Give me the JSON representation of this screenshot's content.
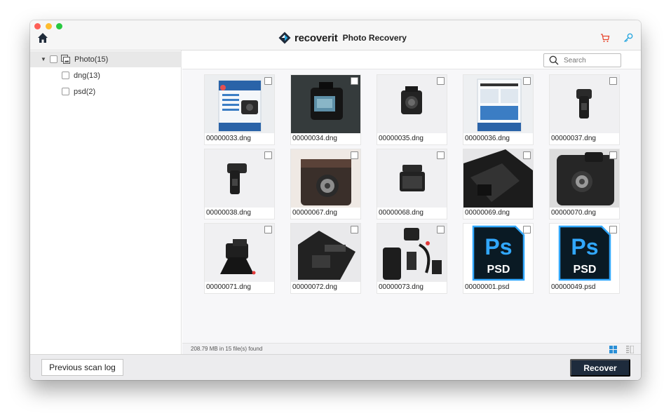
{
  "app": {
    "brand_name": "recoverit",
    "product": "Photo Recovery",
    "accent_color": "#1e2b3c",
    "brand_color": "#2aa8e0"
  },
  "sidebar": {
    "items": [
      {
        "label": "Photo(15)",
        "expanded": true,
        "checked": false
      },
      {
        "label": "dng(13)",
        "checked": false
      },
      {
        "label": "psd(2)",
        "checked": false
      }
    ]
  },
  "search": {
    "placeholder": "Search"
  },
  "files": [
    {
      "name": "00000033.dng",
      "thumb": "box-blue"
    },
    {
      "name": "00000034.dng",
      "thumb": "dashcam-dark"
    },
    {
      "name": "00000035.dng",
      "thumb": "camera-white"
    },
    {
      "name": "00000036.dng",
      "thumb": "box-back"
    },
    {
      "name": "00000037.dng",
      "thumb": "mount-white"
    },
    {
      "name": "00000038.dng",
      "thumb": "mount-white"
    },
    {
      "name": "00000067.dng",
      "thumb": "dashcam-front"
    },
    {
      "name": "00000068.dng",
      "thumb": "screen-white"
    },
    {
      "name": "00000069.dng",
      "thumb": "dashcam-side"
    },
    {
      "name": "00000070.dng",
      "thumb": "dashcam-front-gray"
    },
    {
      "name": "00000071.dng",
      "thumb": "mount-red"
    },
    {
      "name": "00000072.dng",
      "thumb": "dashcam-angle"
    },
    {
      "name": "00000073.dng",
      "thumb": "kit"
    },
    {
      "name": "00000001.psd",
      "thumb": "psd"
    },
    {
      "name": "00000049.psd",
      "thumb": "psd"
    }
  ],
  "status": {
    "summary": "208.79 MB in 15 file(s) found"
  },
  "footer": {
    "prev_scan_label": "Previous scan log",
    "recover_label": "Recover"
  }
}
